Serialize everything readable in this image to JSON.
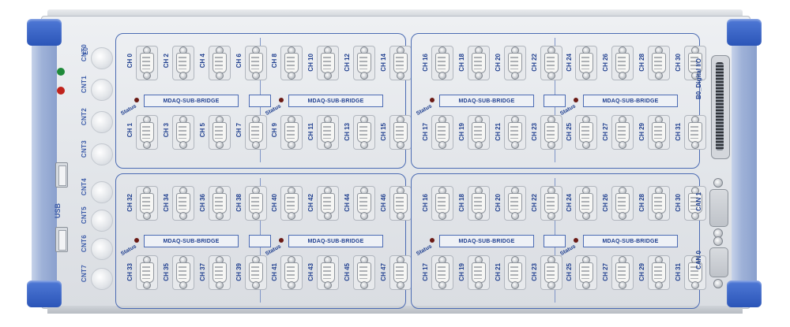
{
  "panel": {
    "left_strip": {
      "eo_label": "E0",
      "counters": [
        "CNT0",
        "CNT1",
        "CNT2",
        "CNT3",
        "CNT4",
        "CNT5",
        "CNT6",
        "CNT7"
      ],
      "usb_logo": "USB",
      "led_colors": [
        "#1f8a3a",
        "#c0231c"
      ]
    },
    "modules": [
      {
        "top_channels": [
          "CH 0",
          "CH 2",
          "CH 4",
          "CH 6",
          "CH 8",
          "CH 10",
          "CH 12",
          "CH 14"
        ],
        "bottom_channels": [
          "CH 1",
          "CH 3",
          "CH 5",
          "CH 7",
          "CH 9",
          "CH 11",
          "CH 13",
          "CH 15"
        ],
        "bridge_labels": [
          "MDAQ-SUB-BRIDGE",
          "MDAQ-SUB-BRIDGE"
        ],
        "status_label": "Status"
      },
      {
        "top_channels": [
          "CH 16",
          "CH 18",
          "CH 20",
          "CH 22",
          "CH 24",
          "CH 26",
          "CH 28",
          "CH 30"
        ],
        "bottom_channels": [
          "CH 17",
          "CH 19",
          "CH 21",
          "CH 23",
          "CH 25",
          "CH 27",
          "CH 29",
          "CH 31"
        ],
        "bridge_labels": [
          "MDAQ-SUB-BRIDGE",
          "MDAQ-SUB-BRIDGE"
        ],
        "status_label": "Status"
      },
      {
        "top_channels": [
          "CH 32",
          "CH 34",
          "CH 36",
          "CH 38",
          "CH 40",
          "CH 42",
          "CH 44",
          "CH 46"
        ],
        "bottom_channels": [
          "CH 33",
          "CH 35",
          "CH 37",
          "CH 39",
          "CH 41",
          "CH 43",
          "CH 45",
          "CH 47"
        ],
        "bridge_labels": [
          "MDAQ-SUB-BRIDGE",
          "MDAQ-SUB-BRIDGE"
        ],
        "status_label": "Status"
      },
      {
        "top_channels": [
          "CH 16",
          "CH 18",
          "CH 20",
          "CH 22",
          "CH 24",
          "CH 26",
          "CH 28",
          "CH 30"
        ],
        "bottom_channels": [
          "CH 17",
          "CH 19",
          "CH 21",
          "CH 23",
          "CH 25",
          "CH 27",
          "CH 29",
          "CH 31"
        ],
        "bridge_labels": [
          "MDAQ-SUB-BRIDGE",
          "MDAQ-SUB-BRIDGE"
        ],
        "status_label": "Status"
      }
    ],
    "right_side": {
      "digital_io_label": "B0_Digital I/O",
      "can1_label": "CAN 1",
      "can0_label": "CAN 0"
    },
    "colors": {
      "rail_blue": "#2b55b8",
      "label_blue": "#1f3f8f",
      "panel_gray": "#e3e6ea"
    }
  }
}
